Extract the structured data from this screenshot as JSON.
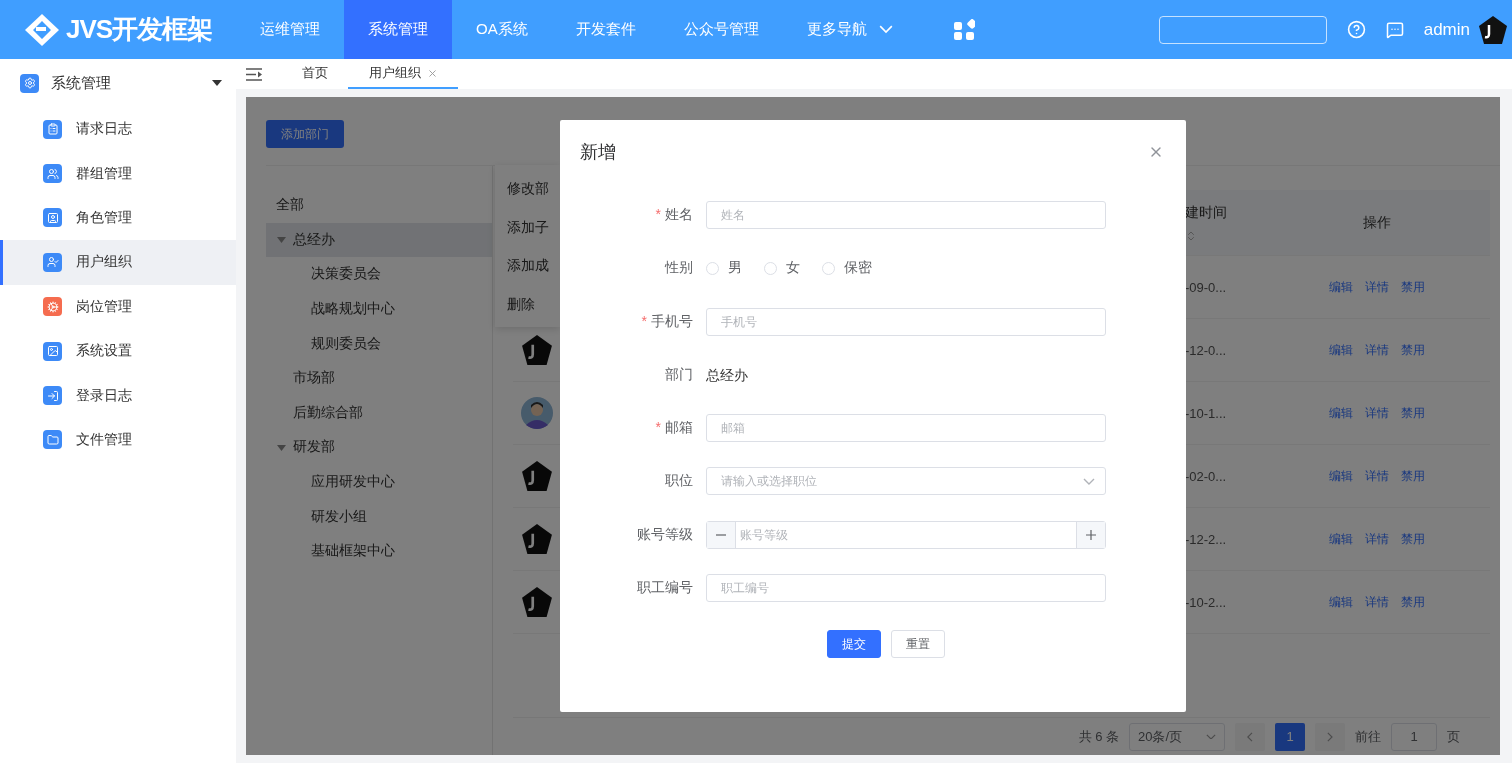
{
  "header": {
    "logo": "JVS开发框架",
    "nav": [
      {
        "label": "运维管理",
        "selected": false,
        "kind": "link"
      },
      {
        "label": "系统管理",
        "selected": true,
        "kind": "link"
      },
      {
        "label": "OA系统",
        "selected": false,
        "kind": "link"
      },
      {
        "label": "开发套件",
        "selected": false,
        "kind": "link"
      },
      {
        "label": "公众号管理",
        "selected": false,
        "kind": "link"
      },
      {
        "label": "更多导航",
        "selected": false,
        "kind": "dropdown"
      }
    ],
    "user": "admin"
  },
  "sidebar": {
    "group": "系统管理",
    "expanded": true,
    "items": [
      {
        "label": "请求日志",
        "selected": false,
        "color": "#3d8af7"
      },
      {
        "label": "群组管理",
        "selected": false,
        "color": "#3d8af7"
      },
      {
        "label": "角色管理",
        "selected": false,
        "color": "#3d8af7"
      },
      {
        "label": "用户组织",
        "selected": true,
        "color": "#3d8af7"
      },
      {
        "label": "岗位管理",
        "selected": false,
        "color": "#f56c4f"
      },
      {
        "label": "系统设置",
        "selected": false,
        "color": "#3d8af7"
      },
      {
        "label": "登录日志",
        "selected": false,
        "color": "#3d8af7"
      },
      {
        "label": "文件管理",
        "selected": false,
        "color": "#3d8af7"
      }
    ]
  },
  "tabs": [
    {
      "label": "首页",
      "selected": false,
      "closable": false
    },
    {
      "label": "用户组织",
      "selected": true,
      "closable": true
    }
  ],
  "page": {
    "add_button": "添加部门",
    "all_label": "全部",
    "tree": [
      {
        "label": "总经办",
        "selected": true,
        "expanded": true,
        "children": [
          {
            "label": "决策委员会",
            "selected": false
          },
          {
            "label": "战略规划中心",
            "selected": false
          },
          {
            "label": "规则委员会",
            "selected": false
          }
        ]
      },
      {
        "label": "市场部",
        "selected": false
      },
      {
        "label": "后勤综合部",
        "selected": false
      },
      {
        "label": "研发部",
        "selected": false,
        "expanded": true,
        "children": [
          {
            "label": "应用研发中心",
            "selected": false
          },
          {
            "label": "研发小组",
            "selected": false
          },
          {
            "label": "基础框架中心",
            "selected": false
          }
        ]
      }
    ],
    "context_menu": [
      "修改部",
      "添加子",
      "添加成",
      "删除"
    ],
    "table": {
      "columns": [
        "建时间",
        "操作"
      ],
      "rows": [
        {
          "column_date": "-09-0...",
          "actions": [
            "编辑",
            "详情",
            "禁用"
          ]
        },
        {
          "kind": "logo",
          "column_date": "-12-0...",
          "actions": [
            "编辑",
            "详情",
            "禁用"
          ]
        },
        {
          "kind": "person",
          "column_date": "-10-1...",
          "actions": [
            "编辑",
            "详情",
            "禁用"
          ]
        },
        {
          "kind": "logo",
          "column_date": "-02-0...",
          "actions": [
            "编辑",
            "详情",
            "禁用"
          ]
        },
        {
          "kind": "logo",
          "column_date": "-12-2...",
          "actions": [
            "编辑",
            "详情",
            "禁用"
          ]
        },
        {
          "kind": "logo",
          "column_date": "-10-2...",
          "actions": [
            "编辑",
            "详情",
            "禁用"
          ]
        }
      ]
    },
    "pagination": {
      "total": "共 6 条",
      "page_size": "20条/页",
      "pages": [
        {
          "label": "1",
          "selected": true
        }
      ],
      "goto_label": "前往",
      "goto_value": "1",
      "page_unit": "页"
    }
  },
  "dialog": {
    "title": "新增",
    "fields": [
      {
        "kind": "input",
        "required_mark": "*",
        "label": "姓名",
        "placeholder": "姓名"
      },
      {
        "kind": "radio",
        "label": "性别",
        "options": [
          {
            "label": "男",
            "selected": false
          },
          {
            "label": "女",
            "selected": false
          },
          {
            "label": "保密",
            "selected": false
          }
        ]
      },
      {
        "kind": "input",
        "required_mark": "*",
        "label": "手机号",
        "placeholder": "手机号"
      },
      {
        "kind": "text",
        "label": "部门",
        "value": "总经办"
      },
      {
        "kind": "input",
        "required_mark": "*",
        "label": "邮箱",
        "placeholder": "邮箱"
      },
      {
        "kind": "select",
        "label": "职位",
        "placeholder": "请输入或选择职位"
      },
      {
        "kind": "number",
        "label": "账号等级",
        "placeholder": "账号等级"
      },
      {
        "kind": "input",
        "label": "职工编号",
        "placeholder": "职工编号"
      }
    ],
    "buttons": [
      {
        "label": "提交",
        "kind": "primary"
      },
      {
        "label": "重置",
        "kind": "default"
      }
    ]
  }
}
